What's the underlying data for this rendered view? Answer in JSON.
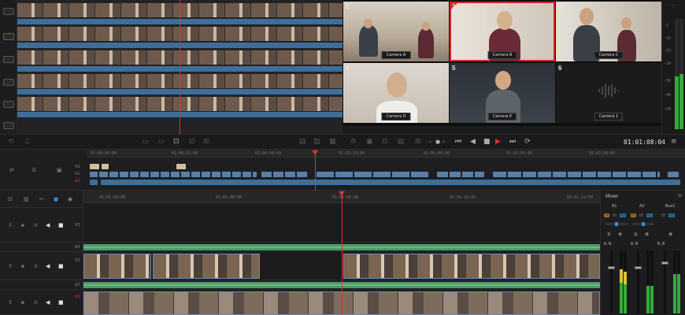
{
  "source_viewer": {
    "track_buttons": [
      "V",
      "V",
      "V",
      "V",
      "V",
      "V"
    ]
  },
  "multicam": {
    "cameras": [
      {
        "num": "1",
        "label": "Camera A"
      },
      {
        "num": "2",
        "label": "Camera B",
        "selected": true
      },
      {
        "num": "3",
        "label": "Camera C"
      },
      {
        "num": "4",
        "label": "Camera D"
      },
      {
        "num": "5",
        "label": "Camera E"
      },
      {
        "num": "6",
        "label": "Camera 1"
      }
    ]
  },
  "meters": {
    "left_ticks": [
      "-5",
      "-10",
      "-15",
      "-20",
      "-30",
      "-40",
      "-50"
    ]
  },
  "transport": {
    "timecode": "01:01:08:04",
    "icons": [
      "go-to-start-icon",
      "step-back-icon",
      "stop-icon",
      "play-icon",
      "go-to-end-icon",
      "loop-icon"
    ]
  },
  "mini_timeline": {
    "ruler": [
      "01:00:00:00",
      "01:00:25:00",
      "01:00:50:00",
      "01:01:15:00",
      "01:01:40:00",
      "01:02:05:00",
      "01:02:30:00"
    ],
    "track_labels": [
      "V2",
      "V1",
      "A1"
    ]
  },
  "main_timeline": {
    "ruler": [
      "01:01:04:00",
      "01:01:06:00",
      "01:01:08:00",
      "01:01:10:00",
      "01:01:12:00"
    ],
    "tracks": [
      {
        "label": "V3"
      },
      {
        "label": "A3"
      },
      {
        "label": "V2"
      },
      {
        "label": "A2"
      },
      {
        "label": "V1"
      }
    ]
  },
  "mixer": {
    "title": "Mixer",
    "channels": [
      "A1",
      "A2",
      "Bus1"
    ],
    "fx_label": "FX",
    "dy_label": "DY",
    "eq_label": "EQ",
    "s_label": "S",
    "m_label": "M",
    "level_values": [
      "0.0",
      "0.0",
      "0.0"
    ]
  },
  "colors": {
    "accent_red": "#dd2222",
    "audio_blue": "#3e6e9a",
    "audio_green": "#4e9a6a",
    "meter_green": "#2fae3a"
  }
}
